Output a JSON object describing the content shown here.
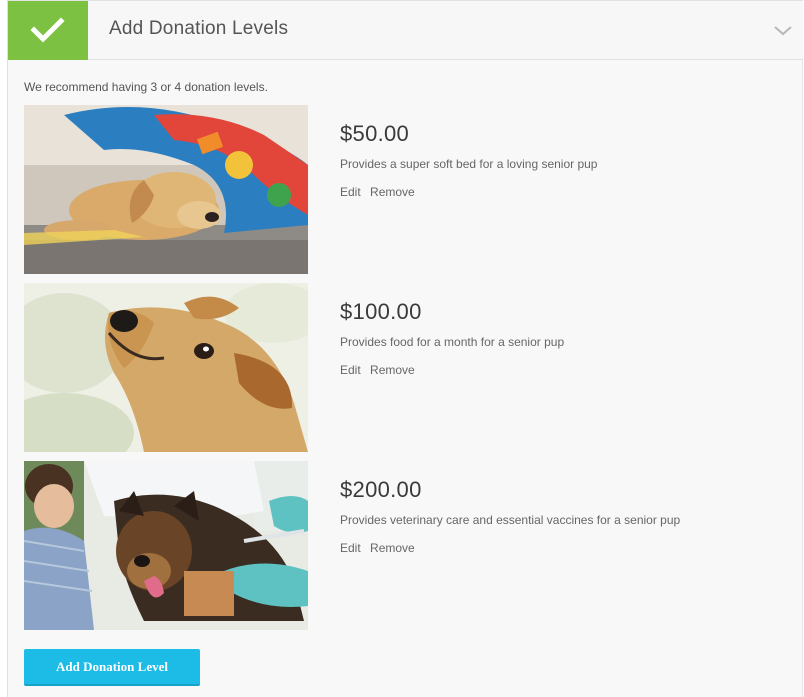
{
  "header": {
    "title": "Add Donation Levels",
    "status_icon": "checkmark-icon",
    "toggle_icon": "chevron-down-icon",
    "accent_color": "#7dc142"
  },
  "intro_text": "We recommend having 3 or 4 donation levels.",
  "levels": [
    {
      "amount": "$50.00",
      "description": "Provides a super soft bed for a loving senior pup",
      "edit_label": "Edit",
      "remove_label": "Remove",
      "image": "dog-sleeping-under-blanket-photo"
    },
    {
      "amount": "$100.00",
      "description": "Provides food for a month for a senior pup",
      "edit_label": "Edit",
      "remove_label": "Remove",
      "image": "dog-looking-up-photo"
    },
    {
      "amount": "$200.00",
      "description": "Provides veterinary care and essential vaccines for a senior pup",
      "edit_label": "Edit",
      "remove_label": "Remove",
      "image": "dog-at-vet-photo"
    }
  ],
  "add_button": {
    "label": "Add Donation Level",
    "color": "#1dbce6"
  }
}
